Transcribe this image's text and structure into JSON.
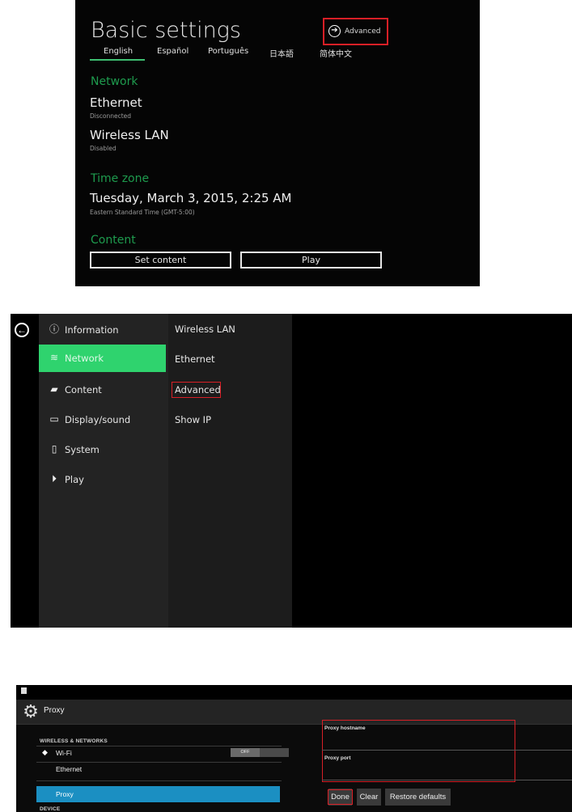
{
  "panel1": {
    "title": "Basic settings",
    "advanced_label": "Advanced",
    "languages": [
      "English",
      "Español",
      "Português",
      "日本語",
      "简体中文"
    ],
    "sections": {
      "network": {
        "heading": "Network",
        "ethernet": {
          "label": "Ethernet",
          "status": "Disconnected"
        },
        "wireless": {
          "label": "Wireless LAN",
          "status": "Disabled"
        }
      },
      "timezone": {
        "heading": "Time zone",
        "datetime": "Tuesday, March 3, 2015, 2:25 AM",
        "zone": "Eastern Standard Time (GMT-5:00)"
      },
      "content": {
        "heading": "Content",
        "set_content": "Set content",
        "play": "Play"
      }
    },
    "accent_color": "#1e9b4e",
    "highlight_color": "#d81f26"
  },
  "panel2": {
    "menu": [
      {
        "label": "Information",
        "icon": "info-icon"
      },
      {
        "label": "Network",
        "icon": "network-icon"
      },
      {
        "label": "Content",
        "icon": "content-icon"
      },
      {
        "label": "Display/sound",
        "icon": "display-icon"
      },
      {
        "label": "System",
        "icon": "system-icon"
      },
      {
        "label": "Play",
        "icon": "play-icon"
      }
    ],
    "submenu": [
      "Wireless LAN",
      "Ethernet",
      "Advanced",
      "Show IP"
    ],
    "selected_color": "#2fd36e"
  },
  "panel3": {
    "title": "Proxy",
    "section_wireless": "WIRELESS & NETWORKS",
    "wifi_label": "Wi-Fi",
    "wifi_toggle": "OFF",
    "ethernet_label": "Ethernet",
    "proxy_label": "Proxy",
    "section_device": "DEVICE",
    "proxy_hostname_label": "Proxy hostname",
    "proxy_port_label": "Proxy port",
    "buttons": {
      "done": "Done",
      "clear": "Clear",
      "restore": "Restore defaults"
    },
    "selected_color": "#1b8fc2"
  }
}
